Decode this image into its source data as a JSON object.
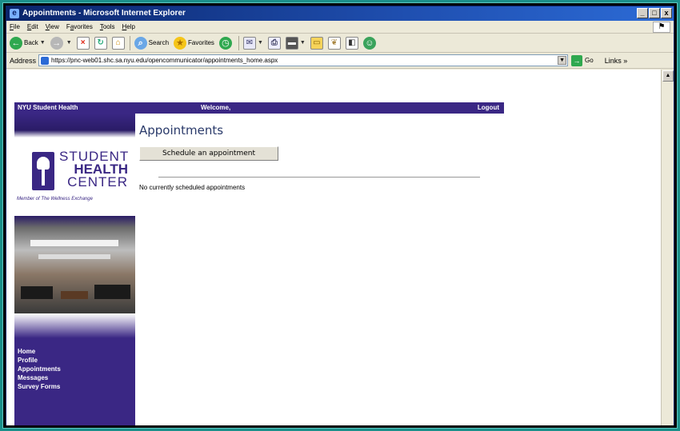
{
  "window": {
    "title": "Appointments - Microsoft Internet Explorer",
    "controls": [
      "_",
      "□",
      "x"
    ]
  },
  "menu": [
    "File",
    "Edit",
    "View",
    "Favorites",
    "Tools",
    "Help"
  ],
  "menu_mnemonics": [
    "F",
    "E",
    "V",
    "a",
    "T",
    "H"
  ],
  "toolbar": {
    "back": "Back",
    "search": "Search",
    "favorites": "Favorites"
  },
  "address": {
    "label": "Address",
    "url": "https://pnc-web01.shc.sa.nyu.edu/opencommunicator/appointments_home.aspx",
    "go": "Go",
    "links": "Links »"
  },
  "site": {
    "brand": "NYU Student Health",
    "welcome": "Welcome,",
    "logout": "Logout",
    "logo_line1": "STUDENT",
    "logo_line2": "HEALTH",
    "logo_line3": "CENTER",
    "logo_tagline": "Member of The Wellness Exchange"
  },
  "nav": [
    "Home",
    "Profile",
    "Appointments",
    "Messages",
    "Survey Forms"
  ],
  "main": {
    "title": "Appointments",
    "schedule_button": "Schedule an appointment",
    "empty_message": "No currently scheduled appointments"
  }
}
